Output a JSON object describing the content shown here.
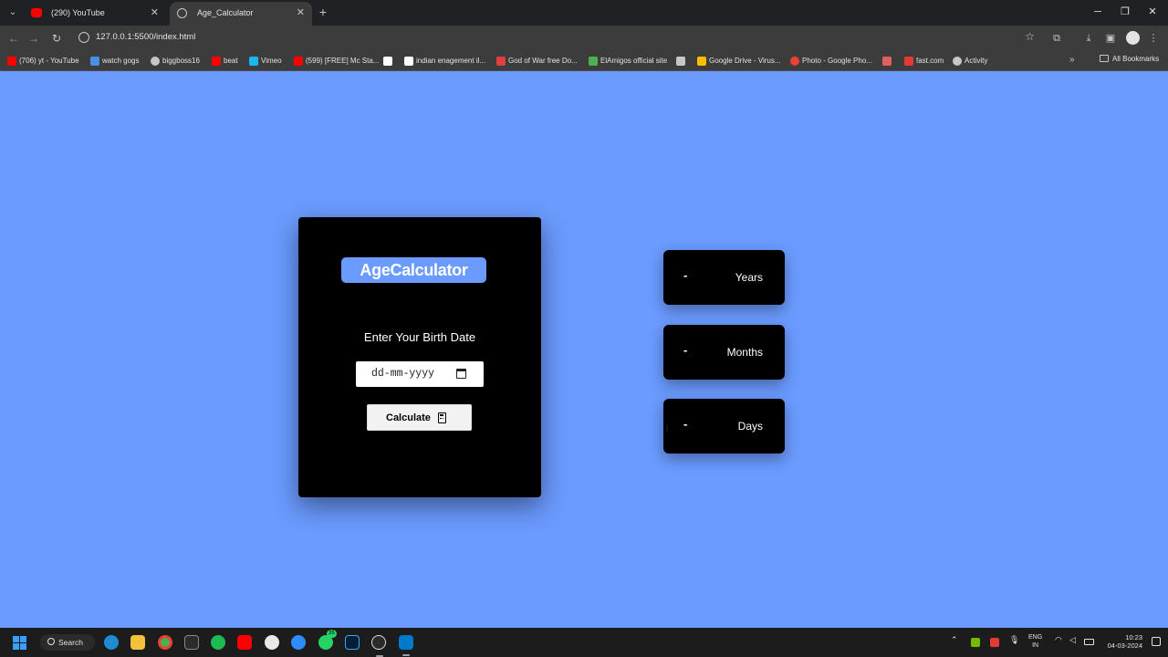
{
  "browser": {
    "tabs": [
      {
        "title": "(290) YouTube",
        "icon": "youtube-icon"
      },
      {
        "title": "Age_Calculator",
        "icon": "globe-icon"
      }
    ],
    "url": "127.0.0.1:5500/index.html",
    "bookmarks": [
      {
        "label": "(706) yt - YouTube",
        "color": "#ff0000"
      },
      {
        "label": "watch gogs",
        "color": "#4a90e2"
      },
      {
        "label": "biggboss16",
        "color": "#c4c7c5"
      },
      {
        "label": "beat",
        "color": "#ff0000"
      },
      {
        "label": "Vimeo",
        "color": "#1ab7ea"
      },
      {
        "label": "(599) [FREE] Mc Sta...",
        "color": "#ff0000"
      },
      {
        "label": "",
        "color": "#ffffff"
      },
      {
        "label": "indian enagement il...",
        "color": "#ffffff"
      },
      {
        "label": "God of War free Do...",
        "color": "#e04040"
      },
      {
        "label": "ElAmigos official site",
        "color": "#4caf50"
      },
      {
        "label": "",
        "color": "#c4c7c5"
      },
      {
        "label": "Google Drive - Virus...",
        "color": "#fbbc04"
      },
      {
        "label": "Photo - Google Pho...",
        "color": "#ea4335"
      },
      {
        "label": "",
        "color": "#e06060"
      },
      {
        "label": "fast.com",
        "color": "#e53935"
      },
      {
        "label": "Activity",
        "color": "#c4c7c5"
      }
    ],
    "all_bookmarks": "All Bookmarks"
  },
  "app": {
    "title": "AgeCalculator",
    "prompt": "Enter Your Birth Date",
    "date_placeholder": "dd-mm-yyyy",
    "calculate_label": "Calculate",
    "results": [
      {
        "value": "-",
        "unit": "Years"
      },
      {
        "value": "-",
        "unit": "Months"
      },
      {
        "value": "-",
        "unit": "Days"
      }
    ],
    "accent_color": "#6b9bff"
  },
  "taskbar": {
    "search_label": "Search",
    "whatsapp_badge": "35",
    "lang_line1": "ENG",
    "lang_line2": "IN",
    "time": "10:23",
    "date": "04-03-2024"
  }
}
